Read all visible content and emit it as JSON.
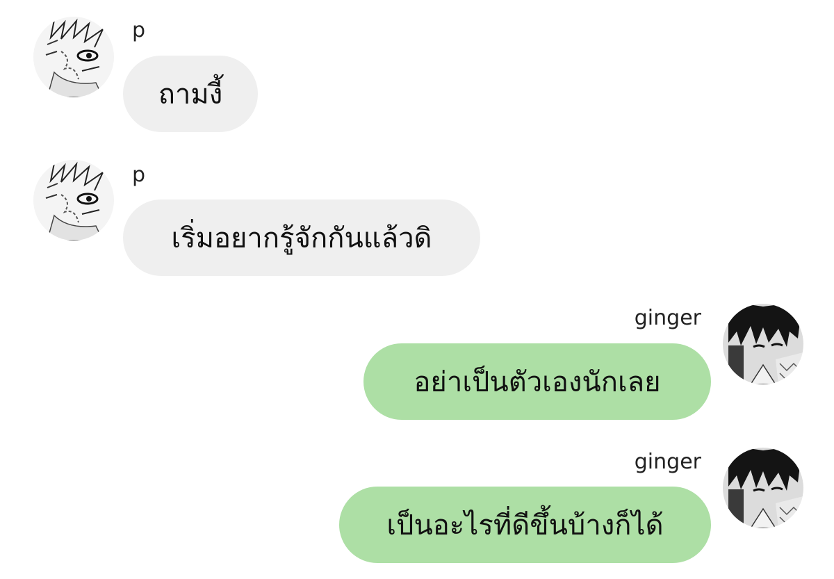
{
  "chat": {
    "messages": [
      {
        "sender": "p",
        "text": "ถามงี้",
        "direction": "incoming",
        "avatar": "manga-boy-scarred-avatar"
      },
      {
        "sender": "p",
        "text": "เริ่มอยากรู้จักกันแล้วดิ",
        "direction": "incoming",
        "avatar": "manga-boy-scarred-avatar"
      },
      {
        "sender": "ginger",
        "text": "อย่าเป็นตัวเองนักเลย",
        "direction": "outgoing",
        "avatar": "manga-dark-hair-avatar"
      },
      {
        "sender": "ginger",
        "text": "เป็นอะไรที่ดีขึ้นบ้างก็ได้",
        "direction": "outgoing",
        "avatar": "manga-dark-hair-avatar"
      }
    ]
  },
  "colors": {
    "incoming_bubble": "#efefef",
    "outgoing_bubble": "#addfa5",
    "background": "#ffffff"
  }
}
